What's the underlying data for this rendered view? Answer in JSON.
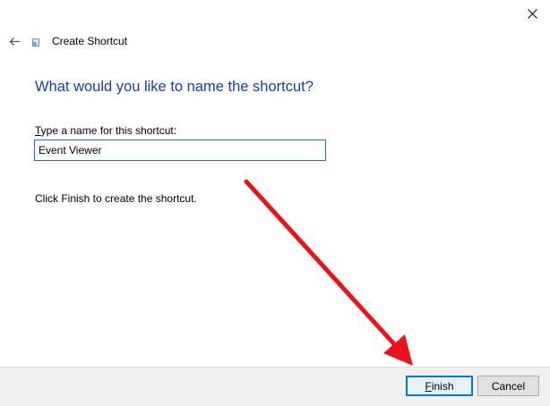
{
  "window": {
    "title": "Create Shortcut"
  },
  "icons": {
    "close": "close-icon",
    "back": "back-arrow-icon",
    "app": "shortcut-app-icon"
  },
  "main": {
    "heading": "What would you like to name the shortcut?",
    "field_label_accel": "T",
    "field_label_rest": "ype a name for this shortcut:",
    "name_value": "Event Viewer",
    "hint": "Click Finish to create the shortcut."
  },
  "buttons": {
    "finish_accel": "F",
    "finish_rest": "inish",
    "cancel": "Cancel"
  },
  "colors": {
    "heading": "#1a3f9a",
    "input_border": "#1a6fc8",
    "default_button_border": "#0078d7",
    "annotation_arrow": "#e8141c"
  }
}
